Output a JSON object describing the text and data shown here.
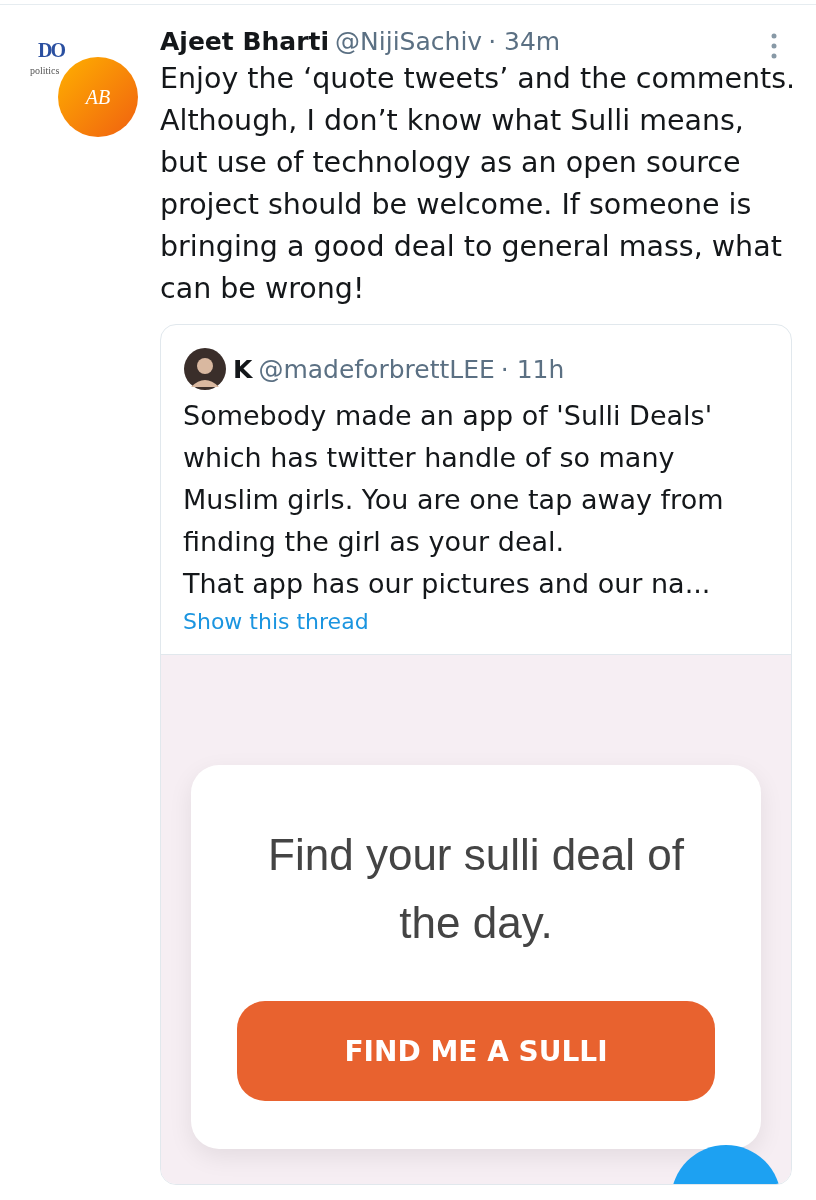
{
  "tweet": {
    "logo": {
      "mark": "DO",
      "caption": "politics",
      "initials": "AB"
    },
    "name": "Ajeet Bharti",
    "handle": "@NijiSachiv",
    "time": "· 34m",
    "text": "Enjoy the ‘quote tweets’ and the comments. Although, I don’t know what Sulli means, but use of technology as an open source project should be welcome. If someone is bringing a good deal to general mass, what can be wrong!"
  },
  "quoted": {
    "name": "K",
    "handle": "@madeforbrettLEE",
    "time": "· 11h",
    "lines": [
      "Somebody made an app of 'Sulli Deals' which has twitter handle of so many Muslim girls. You are one tap away from finding the girl as your deal.",
      "That app has our pictures and our na..."
    ],
    "link": "Show this thread",
    "screenshot": {
      "heading": "Find your sulli deal of the day.",
      "button": "FIND ME A SULLI"
    }
  }
}
